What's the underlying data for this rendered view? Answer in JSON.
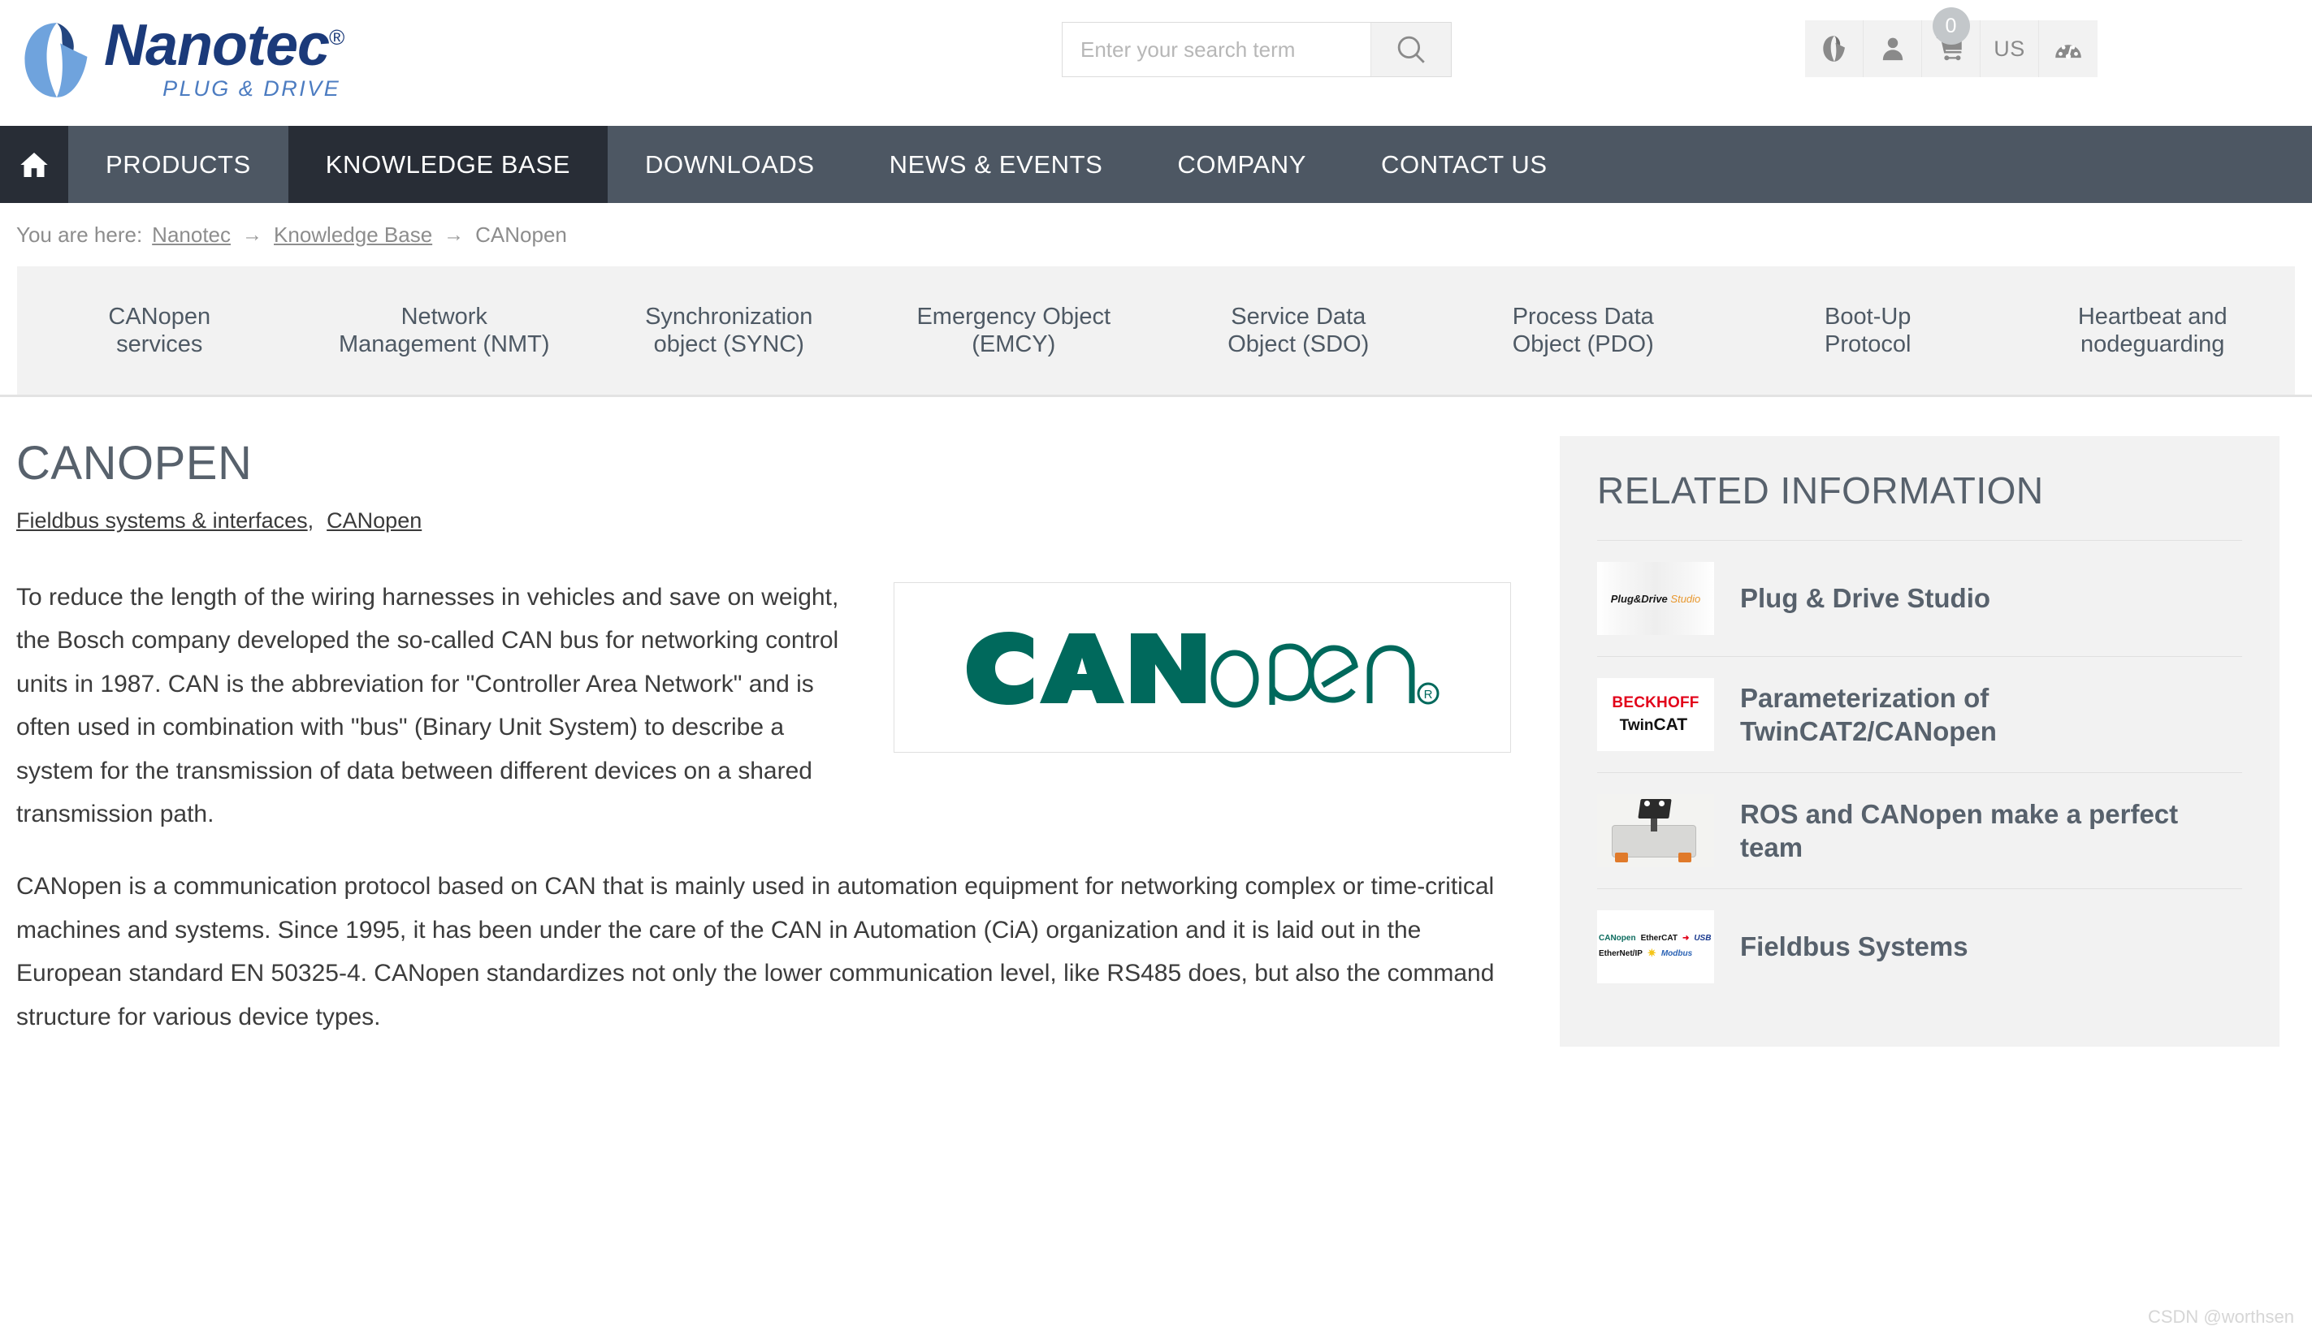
{
  "header": {
    "logo": {
      "name": "Nanotec",
      "registered": "®",
      "tagline": "PLUG & DRIVE"
    },
    "search": {
      "placeholder": "Enter your search term",
      "value": "",
      "icon": "search-icon"
    },
    "icons": [
      {
        "name": "nanotec-mark-icon",
        "label": ""
      },
      {
        "name": "user-account-icon",
        "label": ""
      },
      {
        "name": "shopping-cart-icon",
        "label": "",
        "badge": "0"
      },
      {
        "name": "language-selector",
        "label": "US"
      },
      {
        "name": "dashboard-gauge-icon",
        "label": ""
      }
    ]
  },
  "mainnav": {
    "home_icon": "home-icon",
    "items": [
      {
        "label": "PRODUCTS",
        "active": false
      },
      {
        "label": "KNOWLEDGE BASE",
        "active": true
      },
      {
        "label": "DOWNLOADS",
        "active": false
      },
      {
        "label": "NEWS & EVENTS",
        "active": false
      },
      {
        "label": "COMPANY",
        "active": false
      },
      {
        "label": "CONTACT US",
        "active": false
      }
    ]
  },
  "breadcrumb": {
    "prefix": "You are here:",
    "separator": "→",
    "items": [
      {
        "label": "Nanotec",
        "link": true
      },
      {
        "label": "Knowledge Base",
        "link": true
      },
      {
        "label": "CANopen",
        "link": false
      }
    ]
  },
  "subnav": {
    "items": [
      {
        "line1": "CANopen",
        "line2": "services"
      },
      {
        "line1": "Network",
        "line2": "Management (NMT)"
      },
      {
        "line1": "Synchronization",
        "line2": "object (SYNC)"
      },
      {
        "line1": "Emergency Object",
        "line2": "(EMCY)"
      },
      {
        "line1": "Service Data",
        "line2": "Object (SDO)"
      },
      {
        "line1": "Process Data",
        "line2": "Object (PDO)"
      },
      {
        "line1": "Boot-Up",
        "line2": "Protocol"
      },
      {
        "line1": "Heartbeat and",
        "line2": "nodeguarding"
      }
    ]
  },
  "main": {
    "title": "CANOPEN",
    "tags": [
      {
        "label": "Fieldbus systems & interfaces",
        "trailing": ","
      },
      {
        "label": "CANopen",
        "trailing": ""
      }
    ],
    "figure": {
      "name": "canopen-logo-image",
      "alt": "CANopen",
      "text_can": "CAN",
      "text_open": "open",
      "registered": "®",
      "color": "#00695c"
    },
    "paragraphs": [
      "To reduce the length of the wiring harnesses in vehicles and save on weight, the Bosch company developed the so-called CAN bus for networking control units in 1987. CAN is the abbreviation for \"Controller Area Network\" and is often used in combination with \"bus\" (Binary Unit System) to describe a system for the transmission of data between different devices on a shared transmission path.",
      "CANopen is a communication protocol based on CAN that is mainly used in automation equipment for networking complex or time-critical machines and systems. Since 1995, it has been under the care of the CAN in Automation (CiA) organization and it is laid out in the European standard EN 50325-4. CANopen standardizes not only the lower communication level, like RS485 does, but also the command structure for various device types."
    ]
  },
  "sidebar": {
    "title": "RELATED INFORMATION",
    "items": [
      {
        "label": "Plug & Drive Studio",
        "thumb": "plug-and-drive-studio-thumbnail",
        "thumb_text_1": "Plug&Drive",
        "thumb_text_2": "Studio"
      },
      {
        "label": "Parameterization of TwinCAT2/CANopen",
        "thumb": "beckhoff-twincat-thumbnail",
        "thumb_text_1": "BECKHOFF",
        "thumb_text_2": "TwinCAT"
      },
      {
        "label": "ROS and CANopen make a perfect team",
        "thumb": "ros-robot-thumbnail",
        "thumb_text_1": "",
        "thumb_text_2": ""
      },
      {
        "label": "Fieldbus Systems",
        "thumb": "fieldbus-logos-thumbnail",
        "thumb_text_1": "CANopen EtherCAT USB",
        "thumb_text_2": "EtherNet/IP Modbus"
      }
    ]
  },
  "watermark": "CSDN @worthsen",
  "colors": {
    "nav_bg": "#4d5763",
    "nav_active": "#282d36",
    "subnav_bg": "#f2f2f2",
    "heading": "#57616c",
    "brand_blue": "#1b3a7a",
    "brand_light_blue": "#4c7cc1",
    "canopen_teal": "#00695c",
    "sidebar_bg": "#f2f2f2"
  }
}
